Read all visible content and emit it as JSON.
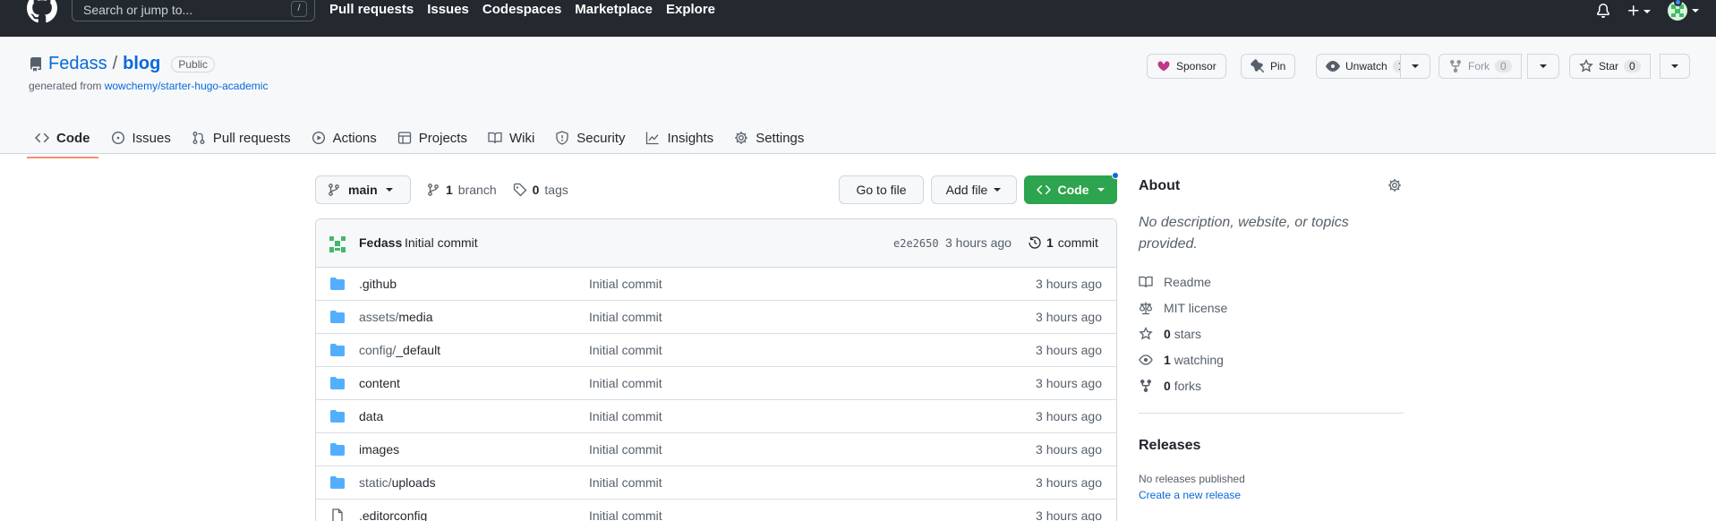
{
  "colors": {
    "header_bg": "#24292f",
    "link": "#0969da",
    "primary_button": "#2da44e",
    "tab_underline": "#fd8c73",
    "folder": "#54aeff"
  },
  "topbar": {
    "search_placeholder": "Search or jump to...",
    "search_shortcut": "/",
    "nav": [
      "Pull requests",
      "Issues",
      "Codespaces",
      "Marketplace",
      "Explore"
    ]
  },
  "repo": {
    "owner": "Fedass",
    "separator": "/",
    "name": "blog",
    "visibility": "Public",
    "generated_prefix": "generated from ",
    "generated_source": "wowchemy/starter-hugo-academic"
  },
  "actions": {
    "sponsor": "Sponsor",
    "pin": "Pin",
    "unwatch": "Unwatch",
    "unwatch_count": "1",
    "fork": "Fork",
    "fork_count": "0",
    "star": "Star",
    "star_count": "0"
  },
  "tabs": [
    {
      "label": "Code",
      "icon": "code-icon"
    },
    {
      "label": "Issues",
      "icon": "issue-icon"
    },
    {
      "label": "Pull requests",
      "icon": "pull-request-icon"
    },
    {
      "label": "Actions",
      "icon": "play-icon"
    },
    {
      "label": "Projects",
      "icon": "table-icon"
    },
    {
      "label": "Wiki",
      "icon": "book-icon"
    },
    {
      "label": "Security",
      "icon": "shield-icon"
    },
    {
      "label": "Insights",
      "icon": "graph-icon"
    },
    {
      "label": "Settings",
      "icon": "gear-icon"
    }
  ],
  "branch": {
    "current": "main",
    "branch_count": "1",
    "branch_label": "branch",
    "tag_count": "0",
    "tag_label": "tags",
    "goto_file": "Go to file",
    "add_file": "Add file",
    "code": "Code"
  },
  "latest_commit": {
    "author": "Fedass",
    "message": "Initial commit",
    "hash": "e2e2650",
    "time": "3 hours ago",
    "count": "1",
    "count_label": "commit"
  },
  "files": [
    {
      "type": "folder",
      "name": ".github",
      "sub": "",
      "message": "Initial commit",
      "time": "3 hours ago"
    },
    {
      "type": "folder",
      "name": "assets/",
      "sub": "media",
      "message": "Initial commit",
      "time": "3 hours ago"
    },
    {
      "type": "folder",
      "name": "config/",
      "sub": "_default",
      "message": "Initial commit",
      "time": "3 hours ago"
    },
    {
      "type": "folder",
      "name": "content",
      "sub": "",
      "message": "Initial commit",
      "time": "3 hours ago"
    },
    {
      "type": "folder",
      "name": "data",
      "sub": "",
      "message": "Initial commit",
      "time": "3 hours ago"
    },
    {
      "type": "folder",
      "name": "images",
      "sub": "",
      "message": "Initial commit",
      "time": "3 hours ago"
    },
    {
      "type": "folder",
      "name": "static/",
      "sub": "uploads",
      "message": "Initial commit",
      "time": "3 hours ago"
    },
    {
      "type": "file",
      "name": ".editorconfig",
      "sub": "",
      "message": "Initial commit",
      "time": "3 hours ago"
    }
  ],
  "about": {
    "title": "About",
    "description": "No description, website, or topics provided.",
    "items": [
      {
        "icon": "book-icon",
        "bold": "",
        "text": "Readme"
      },
      {
        "icon": "scale-icon",
        "bold": "",
        "text": "MIT license"
      },
      {
        "icon": "star-icon",
        "bold": "0",
        "text": "stars"
      },
      {
        "icon": "eye-icon",
        "bold": "1",
        "text": "watching"
      },
      {
        "icon": "fork-icon",
        "bold": "0",
        "text": "forks"
      }
    ]
  },
  "releases": {
    "title": "Releases",
    "none_text": "No releases published",
    "create_link": "Create a new release"
  }
}
